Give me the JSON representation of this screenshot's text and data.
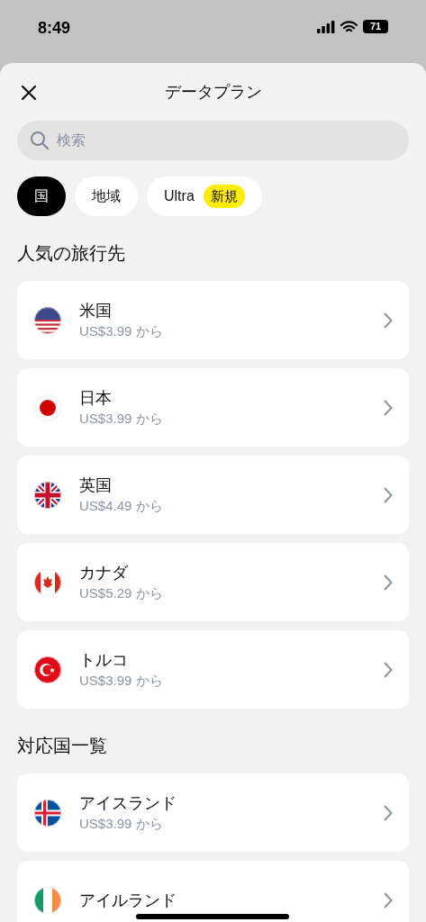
{
  "status_bar": {
    "time": "8:49",
    "battery": "71"
  },
  "header": {
    "title": "データプラン"
  },
  "search": {
    "placeholder": "検索"
  },
  "filters": [
    {
      "label": "国",
      "selected": true
    },
    {
      "label": "地域",
      "selected": false
    },
    {
      "label": "Ultra",
      "selected": false,
      "badge": "新規"
    }
  ],
  "sections": [
    {
      "title": "人気の旅行先",
      "items": [
        {
          "kind": "us",
          "name": "米国",
          "price": "US$3.99 から"
        },
        {
          "kind": "jp",
          "name": "日本",
          "price": "US$3.99 から"
        },
        {
          "kind": "gb",
          "name": "英国",
          "price": "US$4.49 から"
        },
        {
          "kind": "ca",
          "name": "カナダ",
          "price": "US$5.29 から"
        },
        {
          "kind": "tr",
          "name": "トルコ",
          "price": "US$3.99 から"
        }
      ]
    },
    {
      "title": "対応国一覧",
      "items": [
        {
          "kind": "is",
          "name": "アイスランド",
          "price": "US$3.99 から"
        },
        {
          "kind": "ie",
          "name": "アイルランド"
        }
      ]
    }
  ]
}
